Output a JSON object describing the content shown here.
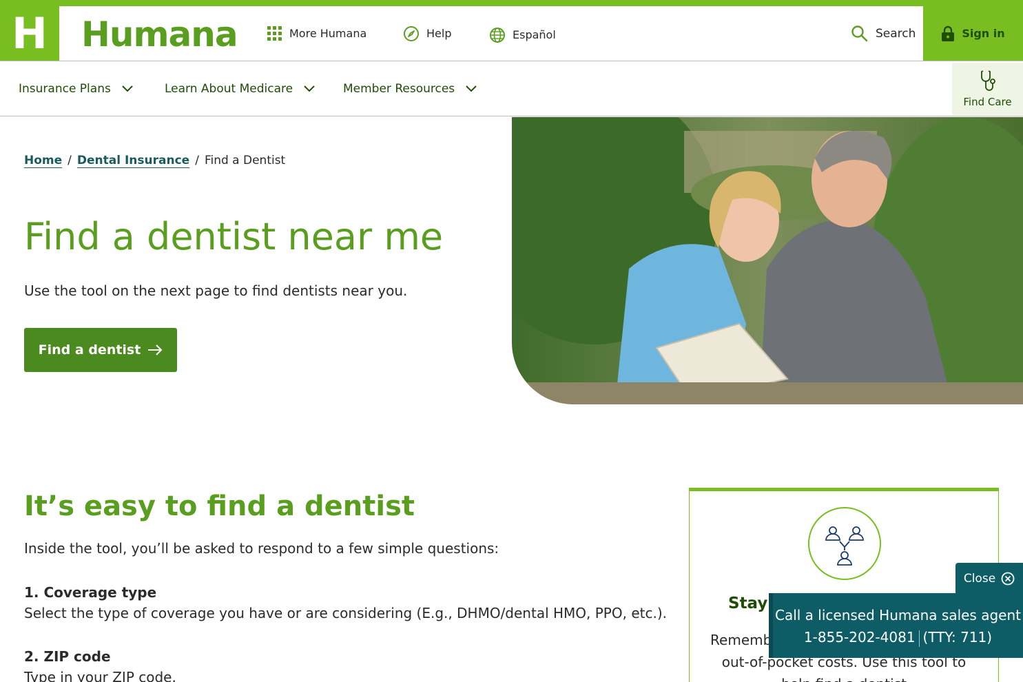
{
  "header": {
    "logo_letter": "H",
    "logo_text": "Humana",
    "utility_links": [
      "More Humana",
      "Help",
      "Español"
    ],
    "search_label": "Search",
    "signin_label": "Sign in"
  },
  "nav": {
    "items": [
      "Insurance Plans",
      "Learn About Medicare",
      "Member Resources"
    ],
    "find_care_label": "Find Care"
  },
  "breadcrumb": {
    "home": "Home",
    "dental": "Dental Insurance",
    "current": "Find a Dentist",
    "separator": "/"
  },
  "hero": {
    "title": "Find a dentist near me",
    "subtitle": "Use the tool on the next page to find dentists near you.",
    "button_label": "Find a dentist"
  },
  "section": {
    "title": "It’s easy to find a dentist",
    "intro": "Inside the tool, you’ll be asked to respond to a few simple questions:",
    "questions": [
      {
        "heading": "1. Coverage type",
        "body": "Select the type of coverage you have or are considering (E.g., DHMO/dental HMO, PPO, etc.)."
      },
      {
        "heading": "2. ZIP code",
        "body": "Type in your ZIP code."
      }
    ]
  },
  "card": {
    "title": "Stay i",
    "body": "Remember plan's network may reduce out-of-pocket costs. Use this tool to help find a dentist"
  },
  "call_widget": {
    "close_label": "Close",
    "line1": "Call a licensed Humana sales agent",
    "phone": "1-855-202-4081",
    "tty": "(TTY: 711)"
  },
  "colors": {
    "brand_green": "#78be20",
    "dark_green": "#4a8a1e",
    "title_green": "#5a9e1f",
    "teal": "#0e5d66"
  }
}
